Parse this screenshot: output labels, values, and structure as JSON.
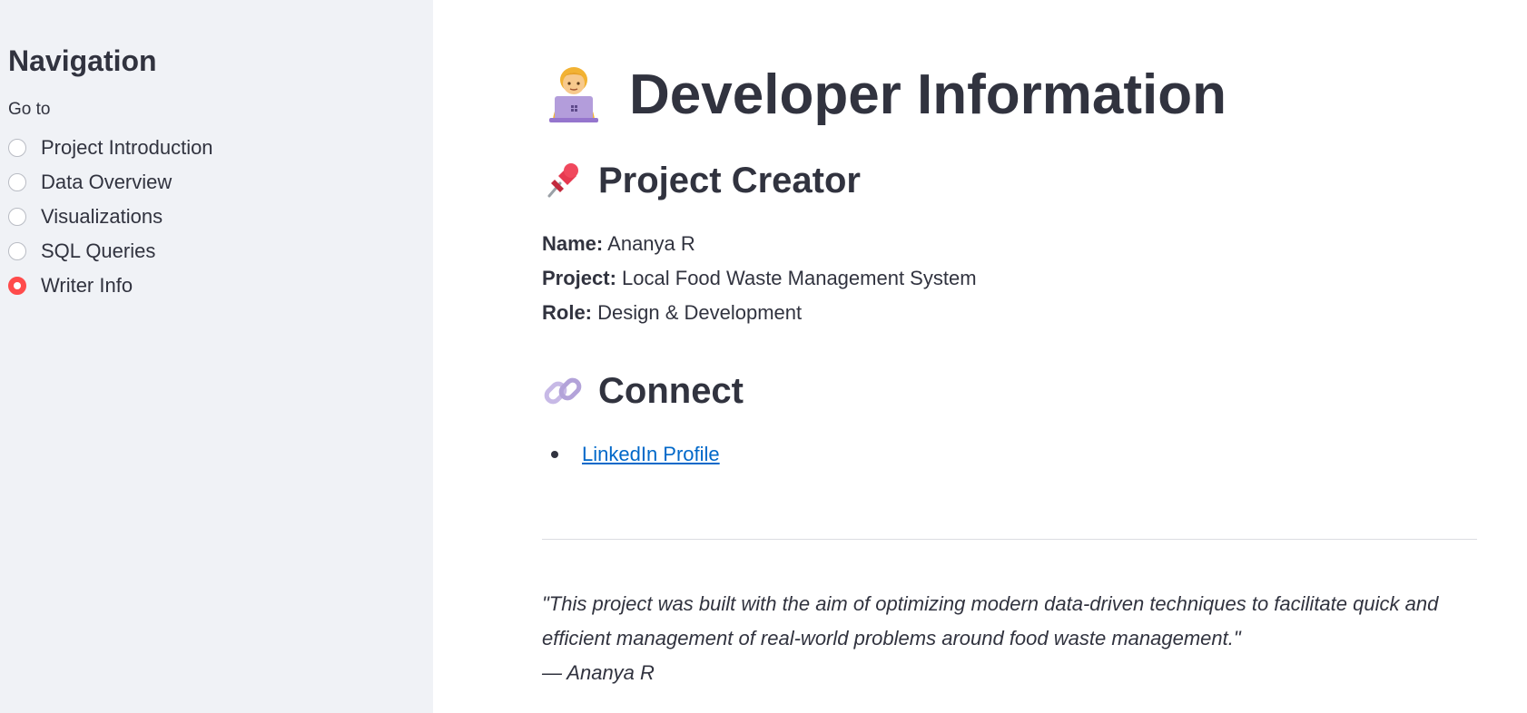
{
  "sidebar": {
    "title": "Navigation",
    "radio_label": "Go to",
    "options": [
      {
        "label": "Project Introduction",
        "selected": false
      },
      {
        "label": "Data Overview",
        "selected": false
      },
      {
        "label": "Visualizations",
        "selected": false
      },
      {
        "label": "SQL Queries",
        "selected": false
      },
      {
        "label": "Writer Info",
        "selected": true
      }
    ]
  },
  "main": {
    "title": "Developer Information",
    "title_icon": "technologist-emoji-icon",
    "creator_section": {
      "icon": "pushpin-icon",
      "title": "Project Creator",
      "name_label": "Name:",
      "name_value": "Ananya R",
      "project_label": "Project:",
      "project_value": "Local Food Waste Management System",
      "role_label": "Role:",
      "role_value": "Design & Development"
    },
    "connect_section": {
      "icon": "link-icon",
      "title": "Connect",
      "links": [
        {
          "label": "LinkedIn Profile"
        }
      ]
    },
    "quote": {
      "text": "\"This project was built with the aim of optimizing modern data-driven techniques to facilitate quick and efficient management of real-world problems around food waste management.\"",
      "attribution": "— Ananya R"
    }
  },
  "colors": {
    "sidebar_bg": "#f0f2f6",
    "accent": "#ff4b4b",
    "link": "#0068c9",
    "text": "#31333f"
  }
}
